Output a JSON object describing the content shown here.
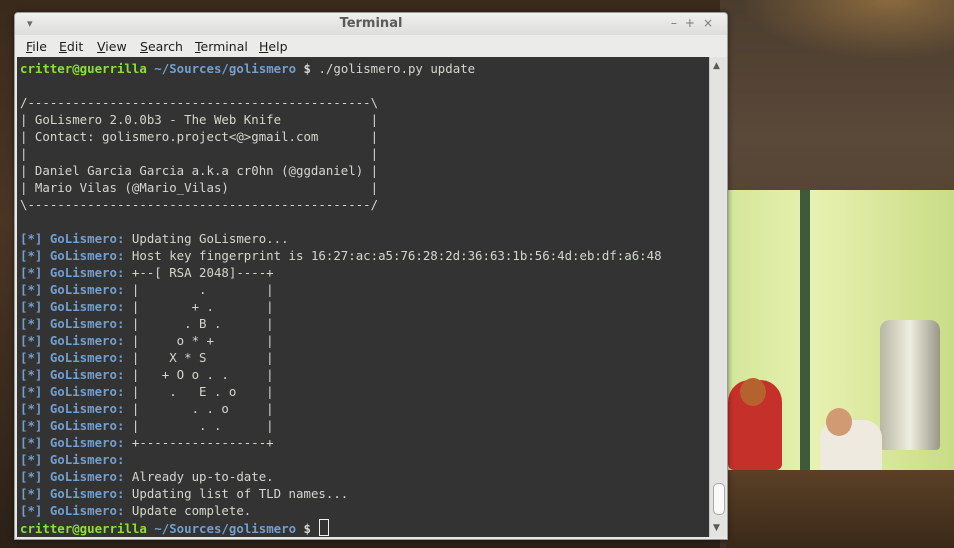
{
  "window": {
    "title": "Terminal",
    "menu_icon": "▾",
    "controls": [
      "–",
      "+",
      "×"
    ]
  },
  "menubar": [
    {
      "label": "File",
      "accel": "F",
      "rest": "ile"
    },
    {
      "label": "Edit",
      "accel": "E",
      "rest": "dit"
    },
    {
      "label": "View",
      "accel": "V",
      "rest": "iew"
    },
    {
      "label": "Search",
      "accel": "S",
      "rest": "earch"
    },
    {
      "label": "Terminal",
      "accel": "T",
      "rest": "erminal"
    },
    {
      "label": "Help",
      "accel": "H",
      "rest": "elp"
    }
  ],
  "prompt": {
    "user_host": "critter@guerrilla",
    "path": "~/Sources/golismero",
    "symbol": "$"
  },
  "command": "./golismero.py update",
  "banner": [
    "/----------------------------------------------\\",
    "| GoLismero 2.0.0b3 - The Web Knife            |",
    "| Contact: golismero.project<@>gmail.com       |",
    "|                                              |",
    "| Daniel Garcia Garcia a.k.a cr0hn (@ggdaniel) |",
    "| Mario Vilas (@Mario_Vilas)                   |",
    "\\----------------------------------------------/"
  ],
  "log_tag": "[*] GoLismero:",
  "log_lines": [
    "Updating GoLismero...",
    "Host key fingerprint is 16:27:ac:a5:76:28:2d:36:63:1b:56:4d:eb:df:a6:48",
    "+--[ RSA 2048]----+",
    "|        .        |",
    "|       + .       |",
    "|      . B .      |",
    "|     o * +       |",
    "|    X * S        |",
    "|   + O o . .     |",
    "|    .   E . o    |",
    "|       . . o     |",
    "|        . .      |",
    "+-----------------+",
    "",
    "Already up-to-date.",
    "Updating list of TLD names...",
    "Update complete."
  ],
  "scrollbar": {
    "up_arrow": "▲",
    "down_arrow": "▼"
  },
  "colors": {
    "terminal_bg": "#333333",
    "prompt_user": "#8ae234",
    "prompt_path": "#729fcf",
    "log_tag": "#729fcf",
    "text": "#d3d7cf"
  }
}
